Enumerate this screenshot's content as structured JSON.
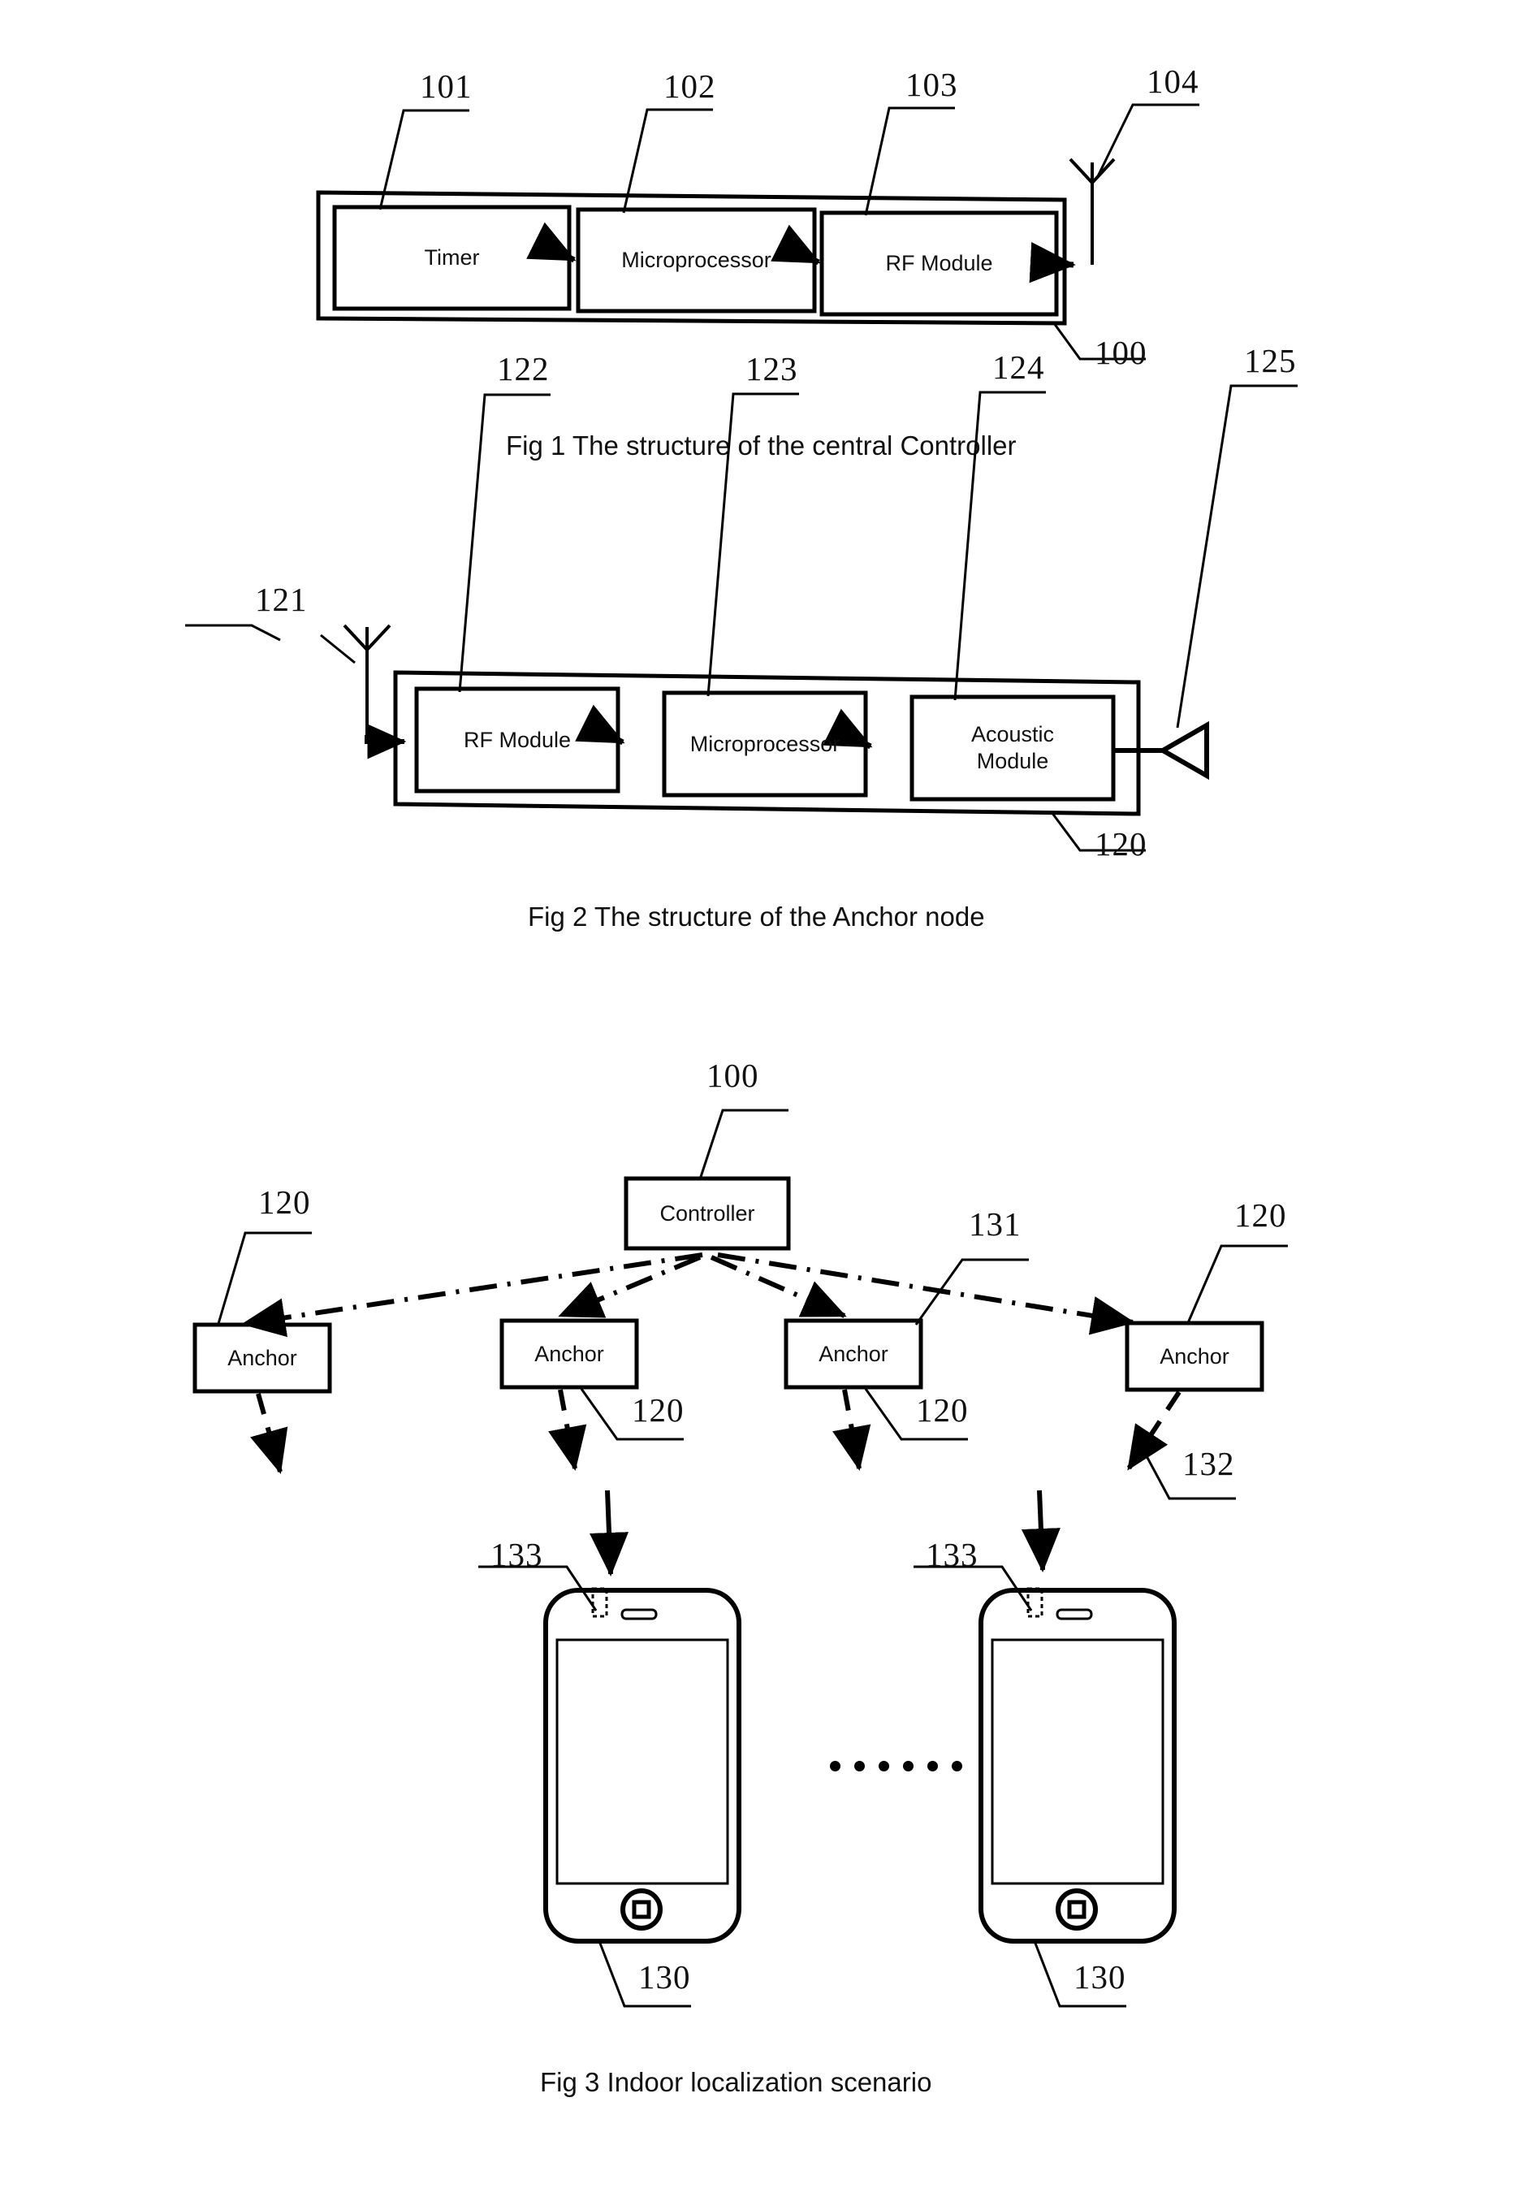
{
  "document": {
    "type": "patent-drawing-sheet",
    "background_color": "#ffffff",
    "ink_color": "#000000"
  },
  "figures": [
    {
      "id": "fig1",
      "caption": "Fig 1 The structure of the central Controller",
      "container_ref": "100",
      "blocks": [
        {
          "ref": "101",
          "label": "Timer"
        },
        {
          "ref": "102",
          "label": "Microprocessor"
        },
        {
          "ref": "103",
          "label": "RF Module"
        }
      ],
      "antenna_ref": "104"
    },
    {
      "id": "fig2",
      "caption": "Fig 2 The structure of the Anchor node",
      "container_ref": "120",
      "antenna_ref": "121",
      "blocks": [
        {
          "ref": "122",
          "label": "RF Module"
        },
        {
          "ref": "123",
          "label": "Microprocessor"
        },
        {
          "ref": "124",
          "label": "Acoustic\nModule"
        }
      ],
      "speaker_ref": "125"
    },
    {
      "id": "fig3",
      "caption": "Fig 3 Indoor localization scenario",
      "controller": {
        "ref": "100",
        "label": "Controller"
      },
      "anchors": [
        {
          "ref": "120",
          "label": "Anchor"
        },
        {
          "ref": "120",
          "label": "Anchor"
        },
        {
          "ref": "120",
          "label": "Anchor"
        },
        {
          "ref": "120",
          "label": "Anchor"
        }
      ],
      "rf_link_ref": "131",
      "acoustic_link_ref": "132",
      "phones": [
        {
          "ref": "130",
          "microphone_ref": "133"
        },
        {
          "ref": "130",
          "microphone_ref": "133"
        }
      ],
      "ellipsis_dot_count": 6
    }
  ],
  "fig1": {
    "caption": "Fig 1 The structure of the central Controller",
    "ref_101": "101",
    "ref_102": "102",
    "ref_103": "103",
    "ref_104": "104",
    "ref_100": "100",
    "block_timer": "Timer",
    "block_micro": "Microprocessor",
    "block_rf": "RF Module"
  },
  "fig2": {
    "caption": "Fig 2 The structure of the Anchor node",
    "ref_121": "121",
    "ref_122": "122",
    "ref_123": "123",
    "ref_124": "124",
    "ref_125": "125",
    "ref_120": "120",
    "block_rf": "RF Module",
    "block_micro": "Microprocessor",
    "block_acoustic": "Acoustic\nModule"
  },
  "fig3": {
    "caption": "Fig 3 Indoor localization scenario",
    "ref_100": "100",
    "ref_131": "131",
    "ref_132": "132",
    "controller_label": "Controller",
    "anchor_label_1": "Anchor",
    "anchor_label_2": "Anchor",
    "anchor_label_3": "Anchor",
    "anchor_label_4": "Anchor",
    "anchor_ref_1": "120",
    "anchor_ref_2": "120",
    "anchor_ref_3": "120",
    "anchor_ref_4": "120",
    "phone_ref_left": "130",
    "phone_ref_right": "130",
    "mic_ref_left": "133",
    "mic_ref_right": "133"
  }
}
